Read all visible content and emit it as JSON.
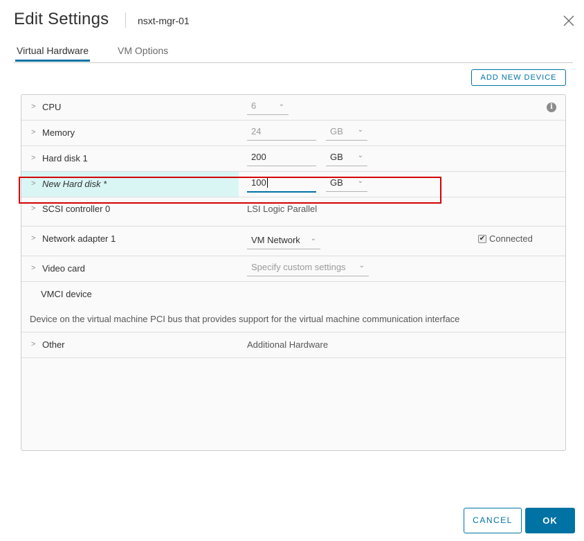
{
  "dialog": {
    "title": "Edit Settings",
    "vm_name": "nsxt-mgr-01",
    "close_icon": "close-icon"
  },
  "tabs": [
    {
      "label": "Virtual Hardware",
      "active": true
    },
    {
      "label": "VM Options",
      "active": false
    }
  ],
  "toolbar": {
    "add_device_label": "ADD NEW DEVICE"
  },
  "hardware": {
    "cpu": {
      "label": "CPU",
      "value": "6",
      "info_icon": "info-icon"
    },
    "memory": {
      "label": "Memory",
      "value": "24",
      "unit": "GB"
    },
    "hard_disk_1": {
      "label": "Hard disk 1",
      "value": "200",
      "unit": "GB"
    },
    "new_hard_disk": {
      "label": "New Hard disk *",
      "value": "100",
      "unit": "GB"
    },
    "scsi": {
      "label": "SCSI controller 0",
      "value": "LSI Logic Parallel"
    },
    "network": {
      "label": "Network adapter 1",
      "value": "VM Network",
      "connected_label": "Connected",
      "connected": true
    },
    "video": {
      "label": "Video card",
      "value": "Specify custom settings"
    },
    "vmci": {
      "label": "VMCI device",
      "description": "Device on the virtual machine PCI bus that provides support for the virtual machine communication interface"
    },
    "other": {
      "label": "Other",
      "value": "Additional Hardware"
    }
  },
  "footer": {
    "cancel_label": "CANCEL",
    "ok_label": "OK"
  },
  "colors": {
    "accent": "#0072a3",
    "highlight": "#d9f6f5",
    "annotation": "#d40000"
  }
}
